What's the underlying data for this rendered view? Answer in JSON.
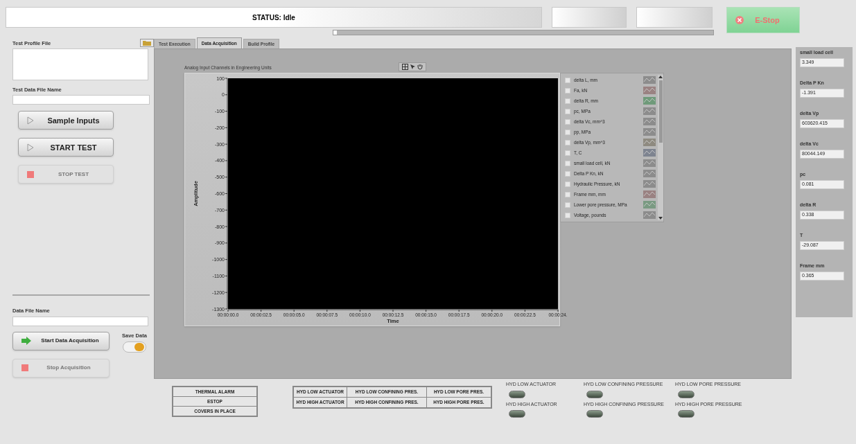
{
  "status_bar": {
    "text": "STATUS: Idle"
  },
  "progress": {
    "level": 0.01
  },
  "estop": {
    "label": "E-Stop"
  },
  "left_panel": {
    "test_profile_file": {
      "label": "Test Profile File"
    },
    "test_data_file_name": {
      "label": "Test Data File Name"
    },
    "buttons": [
      {
        "label": "Sample Inputs",
        "kind": "play",
        "disabled": false
      },
      {
        "label": "START TEST",
        "kind": "play",
        "disabled": false
      },
      {
        "label": "STOP TEST",
        "kind": "stop",
        "disabled": true
      }
    ],
    "data_file_name": {
      "label": "Data File Name"
    },
    "acquisition_buttons": [
      {
        "label": "Start Data Acquisition",
        "kind": "go",
        "disabled": false
      },
      {
        "label": "Stop Acquisition",
        "kind": "stop",
        "disabled": true
      }
    ],
    "save_data": {
      "label": "Save Data",
      "on": true
    }
  },
  "tabs": [
    {
      "label": "Test Execution",
      "selected": false
    },
    {
      "label": "Data Acquisition",
      "selected": true
    },
    {
      "label": "Build Profile",
      "selected": false
    }
  ],
  "graph": {
    "chart_data": {
      "type": "line",
      "title": "Analog Input Channels in Engineering Units",
      "xlabel": "Time",
      "ylabel": "Amplitude",
      "ylim": [
        -1300,
        100
      ],
      "yticks": [
        100,
        0,
        -100,
        -200,
        -300,
        -400,
        -500,
        -600,
        -700,
        -800,
        -900,
        -1000,
        -1100,
        -1200,
        -1300
      ],
      "categories": [
        "00:00:00.0",
        "00:00:02.5",
        "00:00:05.0",
        "00:00:07.5",
        "00:00:10.0",
        "00:00:12.5",
        "00:00:15.0",
        "00:00:17.5",
        "00:00:20.0",
        "00:00:22.5",
        "00:00:24."
      ]
    },
    "legend": [
      {
        "label": "delta L, mm",
        "checked": false,
        "color": "#8c8c8c"
      },
      {
        "label": "Fa, kN",
        "checked": false,
        "color": "#9a8282"
      },
      {
        "label": "delta R, mm",
        "checked": false,
        "color": "#6f9a7a"
      },
      {
        "label": "pc, MPa",
        "checked": false,
        "color": "#8c8c8c"
      },
      {
        "label": "delta Vc, mm^3",
        "checked": false,
        "color": "#8c8c8c"
      },
      {
        "label": "pp, MPa",
        "checked": false,
        "color": "#8c8c8c"
      },
      {
        "label": "delta Vp, mm^3",
        "checked": false,
        "color": "#8e8a80"
      },
      {
        "label": "T, C",
        "checked": false,
        "color": "#7e8490"
      },
      {
        "label": "small load cell, kN",
        "checked": false,
        "color": "#8c8c8c"
      },
      {
        "label": "Delta P Kn, kN",
        "checked": false,
        "color": "#8c8c8c"
      },
      {
        "label": "Hydraulic Pressure, kN",
        "checked": false,
        "color": "#8c8c8c"
      },
      {
        "label": "Frame mm, mm",
        "checked": false,
        "color": "#9a8282"
      },
      {
        "label": "Lower pore pressure, MPa",
        "checked": false,
        "color": "#7a9a82"
      },
      {
        "label": "Voltage, pounds",
        "checked": false,
        "color": "#8c8c8c"
      }
    ]
  },
  "readings": [
    {
      "label": "small load cell",
      "value": "3.349"
    },
    {
      "label": "Delta P Kn",
      "value": "-1.391"
    },
    {
      "label": "delta Vp",
      "value": "603620.415"
    },
    {
      "label": "delta Vc",
      "value": "80044.149"
    },
    {
      "label": "pc",
      "value": "0.081"
    },
    {
      "label": "delta R",
      "value": "0.338"
    },
    {
      "label": "T",
      "value": "-29.087"
    },
    {
      "label": "Frame mm",
      "value": "0.365"
    }
  ],
  "alarms": [
    "THERMAL ALARM",
    "ESTOP",
    "COVERS IN PLACE"
  ],
  "hyd_indicators": [
    [
      "HYD LOW ACTUATOR",
      "HYD LOW CONFINING PRES.",
      "HYD LOW PORE PRES."
    ],
    [
      "HYD HIGH ACTUATOR",
      "HYD HIGH CONFINING PRES.",
      "HYD HIGH PORE PRES."
    ]
  ],
  "hyd_leds": [
    {
      "label": "HYD LOW ACTUATOR",
      "on": false
    },
    {
      "label": "HYD LOW CONFINING PRESSURE",
      "on": false
    },
    {
      "label": "HYD LOW PORE PRESSURE",
      "on": false
    },
    {
      "label": "HYD HIGH ACTUATOR",
      "on": false
    },
    {
      "label": "HYD HIGH CONFINING PRESSURE",
      "on": false
    },
    {
      "label": "HYD HIGH PORE PRESSURE",
      "on": false
    }
  ]
}
